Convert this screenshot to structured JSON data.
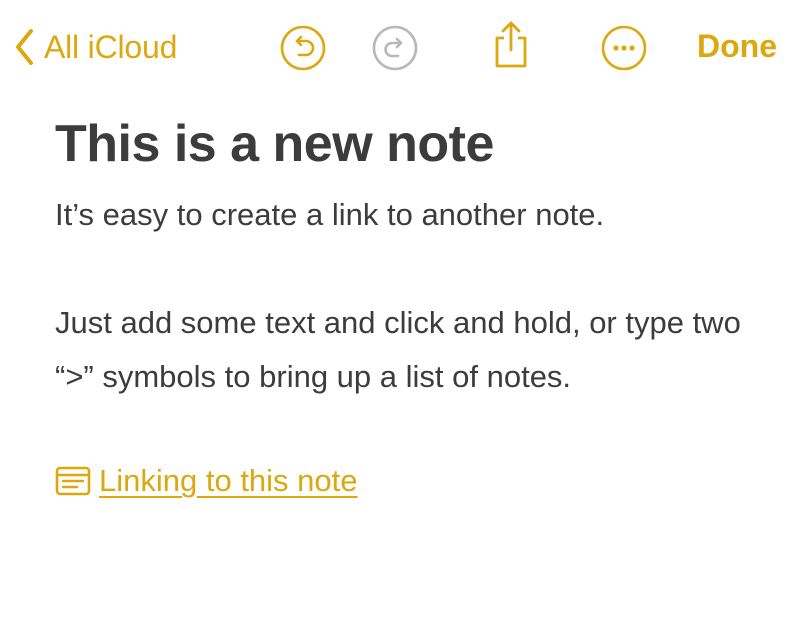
{
  "toolbar": {
    "back_label": "All iCloud",
    "back_icon": "chevron-left-icon",
    "undo_icon": "undo-icon",
    "redo_icon": "redo-icon",
    "share_icon": "share-icon",
    "more_icon": "ellipsis-circle-icon",
    "done_label": "Done",
    "accent_color": "#DDA80F",
    "disabled_color": "#B8B8B8"
  },
  "note": {
    "title": "This is a new note",
    "paragraphs": [
      "It’s easy to create a link to another note.",
      "Just add some text and click and hold, or type two “>” symbols to bring up a list of notes."
    ],
    "link": {
      "icon": "note-icon",
      "label": "Linking to this note"
    }
  }
}
